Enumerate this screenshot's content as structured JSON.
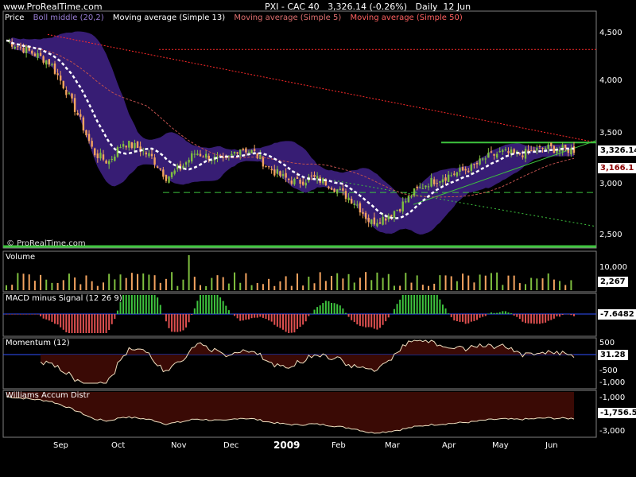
{
  "header": {
    "site": "www.ProRealTime.com",
    "instrument": "PXI - CAC 40",
    "last": "3,326.14 (-0.26%)",
    "period": "Daily",
    "date": "12 Jun"
  },
  "watermark": "© ProRealTime.com",
  "colors": {
    "background": "#000000",
    "up": "#7fbf3f",
    "down": "#f4a460",
    "band": "#3a1f7a",
    "ma13": "#ffffff",
    "ma5": "#c0504d",
    "ma50": "#ff2a2a",
    "green": "#3ec43e",
    "axis": "#808080",
    "zero_line": "#3050ff",
    "macd_up": "#3ec43e",
    "macd_down": "#e05050",
    "momentum_fill": "#3a0a05",
    "williams_fill": "#3a0a05"
  },
  "chart_data": [
    {
      "id": "price",
      "type": "candlestick",
      "legend": [
        "Price",
        "Boll middle (20,2)",
        "Moving average (Simple 13)",
        "Moving average (Simple 5)",
        "Moving average (Simple 50)"
      ],
      "y_ticks": [
        "4,500",
        "4,000",
        "3,500",
        "3,000",
        "2,500"
      ],
      "ylim": [
        2400,
        4650
      ],
      "current": "3,326.14",
      "marker": "3,166.1",
      "x_months": [
        "Sep",
        "Oct",
        "Nov",
        "Dec",
        "2009",
        "Feb",
        "Mar",
        "Apr",
        "May",
        "Jun"
      ],
      "closes_monthly": {
        "Sep": [
          4420,
          4350,
          4280,
          4200
        ],
        "Oct": [
          3950,
          3650,
          3300,
          3200,
          3400
        ],
        "Nov": [
          3350,
          3250,
          3050,
          3150
        ],
        "Dec": [
          3300,
          3250,
          3200,
          3350
        ],
        "Jan": [
          3300,
          3150,
          3050,
          3000
        ],
        "Feb": [
          3050,
          3000,
          2900,
          2800
        ],
        "Mar": [
          2600,
          2650,
          2750,
          2900
        ],
        "Apr": [
          3000,
          3050,
          3100,
          3150
        ],
        "May": [
          3250,
          3300,
          3280,
          3300
        ],
        "Jun": [
          3350,
          3330,
          3326.14
        ]
      },
      "support_level": 2900,
      "resistance_level": 3400
    },
    {
      "id": "volume",
      "type": "bar",
      "title": "Volume",
      "y_ticks": [
        "10,000"
      ],
      "current": "2,267"
    },
    {
      "id": "macd",
      "type": "bar",
      "title": "MACD minus Signal (12 26 9)",
      "current": "-7.6482"
    },
    {
      "id": "momentum",
      "type": "area",
      "title": "Momentum (12)",
      "y_ticks": [
        "500",
        "-500",
        "-1,000"
      ],
      "current": "31.28"
    },
    {
      "id": "williams",
      "type": "area",
      "title": "Williams Accum Distr",
      "y_ticks": [
        "-1,000",
        "-3,000"
      ],
      "current": "-1,756.5"
    }
  ]
}
